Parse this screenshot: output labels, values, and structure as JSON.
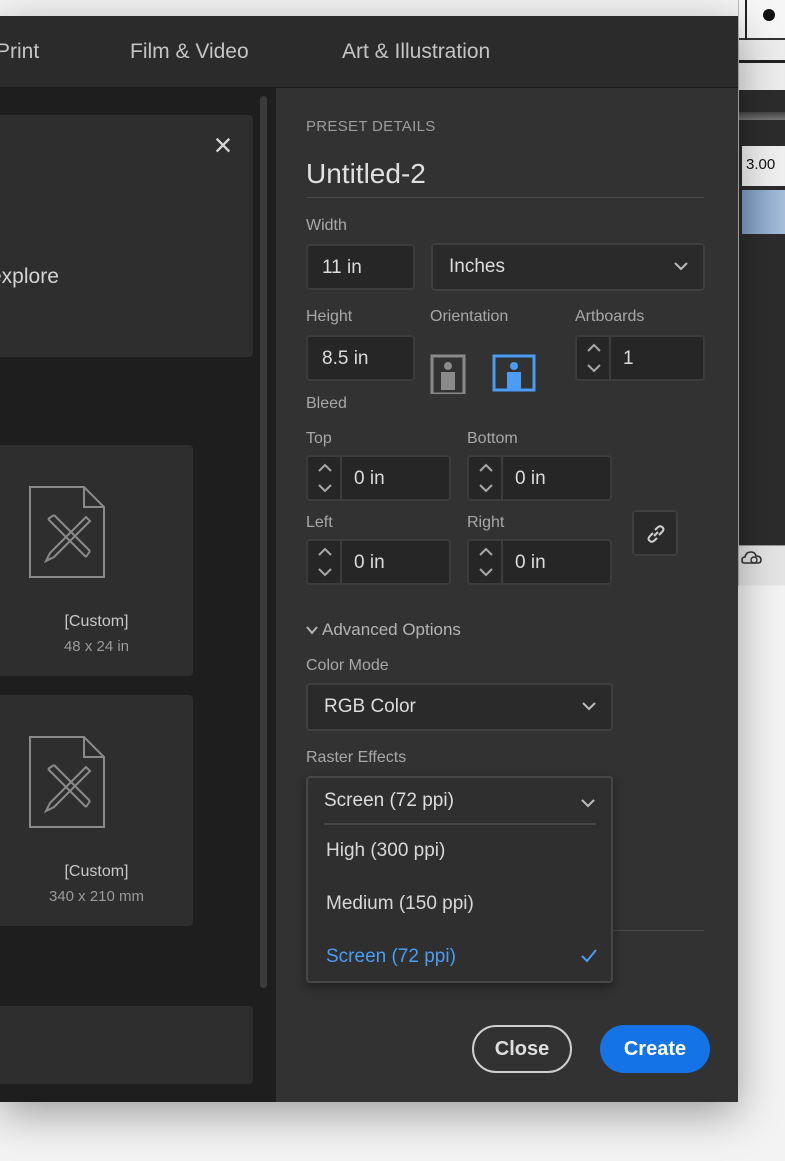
{
  "tabs": [
    "Print",
    "Film & Video",
    "Art & Illustration"
  ],
  "left": {
    "explore_text": "explore",
    "presets": [
      {
        "name": "[Custom]",
        "size": "48 x 24 in"
      },
      {
        "name": "[Custom]",
        "size": "340 x 210 mm"
      }
    ]
  },
  "details": {
    "section_title": "PRESET DETAILS",
    "doc_name": "Untitled-2",
    "width_label": "Width",
    "width_value": "11 in",
    "units": "Inches",
    "height_label": "Height",
    "height_value": "8.5 in",
    "orientation_label": "Orientation",
    "artboards_label": "Artboards",
    "artboards_value": "1",
    "bleed_label": "Bleed",
    "bleed": {
      "top_label": "Top",
      "top_value": "0 in",
      "bottom_label": "Bottom",
      "bottom_value": "0 in",
      "left_label": "Left",
      "left_value": "0 in",
      "right_label": "Right",
      "right_value": "0 in"
    },
    "advanced_label": "Advanced Options",
    "color_mode_label": "Color Mode",
    "color_mode_value": "RGB Color",
    "raster_label": "Raster Effects",
    "raster_value": "Screen (72 ppi)",
    "raster_options": [
      "High (300 ppi)",
      "Medium (150 ppi)",
      "Screen (72 ppi)"
    ]
  },
  "buttons": {
    "close": "Close",
    "create": "Create"
  },
  "background_app": {
    "value": "3.00"
  },
  "colors": {
    "accent": "#1473e6",
    "selected": "#4b9cf5",
    "panel": "#323232"
  }
}
